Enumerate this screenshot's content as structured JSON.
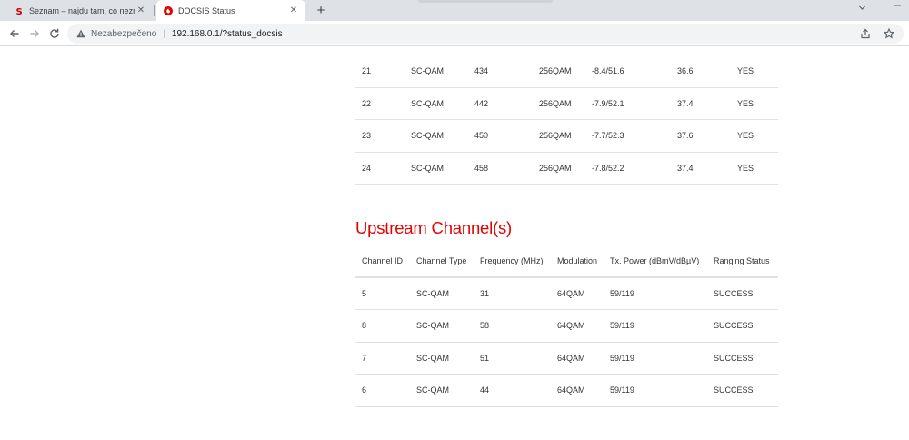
{
  "browser": {
    "tabs": [
      {
        "title": "Seznam – najdu tam, co neznám",
        "favicon": "seznam-s-icon",
        "active": false
      },
      {
        "title": "DOCSIS Status",
        "favicon": "vodafone-icon",
        "active": true
      }
    ],
    "new_tab_label": "+",
    "address": {
      "security_label": "Nezabezpečeno",
      "url": "192.168.0.1/?status_docsis"
    }
  },
  "downstream": {
    "rows": [
      [
        "21",
        "SC-QAM",
        "434",
        "256QAM",
        "-8.4/51.6",
        "36.6",
        "YES"
      ],
      [
        "22",
        "SC-QAM",
        "442",
        "256QAM",
        "-7.9/52.1",
        "37.4",
        "YES"
      ],
      [
        "23",
        "SC-QAM",
        "450",
        "256QAM",
        "-7.7/52.3",
        "37.6",
        "YES"
      ],
      [
        "24",
        "SC-QAM",
        "458",
        "256QAM",
        "-7.8/52.2",
        "37.4",
        "YES"
      ]
    ]
  },
  "upstream": {
    "title": "Upstream Channel(s)",
    "headers": [
      "Channel ID",
      "Channel Type",
      "Frequency (MHz)",
      "Modulation",
      "Tx. Power (dBmV/dBµV)",
      "Ranging Status"
    ],
    "rows": [
      [
        "5",
        "SC-QAM",
        "31",
        "64QAM",
        "59/119",
        "SUCCESS"
      ],
      [
        "8",
        "SC-QAM",
        "58",
        "64QAM",
        "59/119",
        "SUCCESS"
      ],
      [
        "7",
        "SC-QAM",
        "51",
        "64QAM",
        "59/119",
        "SUCCESS"
      ],
      [
        "6",
        "SC-QAM",
        "44",
        "64QAM",
        "59/119",
        "SUCCESS"
      ]
    ]
  },
  "colors": {
    "accent": "#e60000",
    "tabstrip": "#dee1e6",
    "omnibox": "#f1f3f4",
    "rule": "#dee2e6"
  }
}
